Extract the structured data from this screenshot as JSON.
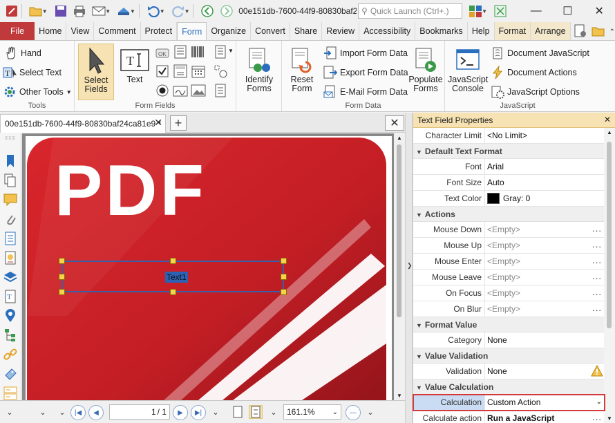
{
  "titlebar": {
    "title": "00e151db-7600-44f9-80830baf2...",
    "quick_launch_placeholder": "Quick Launch (Ctrl+.)"
  },
  "tabs": [
    {
      "label": "File"
    },
    {
      "label": "Home"
    },
    {
      "label": "View"
    },
    {
      "label": "Comment"
    },
    {
      "label": "Protect"
    },
    {
      "label": "Form"
    },
    {
      "label": "Organize"
    },
    {
      "label": "Convert"
    },
    {
      "label": "Share"
    },
    {
      "label": "Review"
    },
    {
      "label": "Accessibility"
    },
    {
      "label": "Bookmarks"
    },
    {
      "label": "Help"
    },
    {
      "label": "Format"
    },
    {
      "label": "Arrange"
    }
  ],
  "ribbon": {
    "tools": {
      "label": "Tools",
      "hand": "Hand",
      "select_text": "Select Text",
      "other_tools": "Other Tools"
    },
    "form_fields": {
      "label": "Form Fields",
      "select_fields_line1": "Select",
      "select_fields_line2": "Fields",
      "text": "Text",
      "ok_label": "OK"
    },
    "identify": {
      "line1": "Identify",
      "line2": "Forms"
    },
    "form_data": {
      "label": "Form Data",
      "reset_line1": "Reset",
      "reset_line2": "Form",
      "import": "Import Form Data",
      "export": "Export Form Data",
      "email": "E-Mail Form Data",
      "populate_line1": "Populate",
      "populate_line2": "Forms"
    },
    "javascript": {
      "label": "JavaScript",
      "console_line1": "JavaScript",
      "console_line2": "Console",
      "doc_js": "Document JavaScript",
      "doc_actions": "Document Actions",
      "js_options": "JavaScript Options"
    }
  },
  "document": {
    "tab_title": "00e151db-7600-44f9-80830baf24ca81e9 *",
    "page_text": "PDF",
    "field_label": "Text1"
  },
  "properties": {
    "title": "Text Field Properties",
    "character_limit": {
      "label": "Character Limit",
      "value": "<No Limit>"
    },
    "cat_default_format": "Default Text Format",
    "font": {
      "label": "Font",
      "value": "Arial"
    },
    "font_size": {
      "label": "Font Size",
      "value": "Auto"
    },
    "text_color": {
      "label": "Text Color",
      "value": "Gray: 0"
    },
    "cat_actions": "Actions",
    "mouse_down": {
      "label": "Mouse Down",
      "value": "<Empty>"
    },
    "mouse_up": {
      "label": "Mouse Up",
      "value": "<Empty>"
    },
    "mouse_enter": {
      "label": "Mouse Enter",
      "value": "<Empty>"
    },
    "mouse_leave": {
      "label": "Mouse Leave",
      "value": "<Empty>"
    },
    "on_focus": {
      "label": "On Focus",
      "value": "<Empty>"
    },
    "on_blur": {
      "label": "On Blur",
      "value": "<Empty>"
    },
    "cat_format_value": "Format Value",
    "category": {
      "label": "Category",
      "value": "None"
    },
    "cat_validation": "Value Validation",
    "validation": {
      "label": "Validation",
      "value": "None"
    },
    "cat_calculation": "Value Calculation",
    "calculation": {
      "label": "Calculation",
      "value": "Custom Action"
    },
    "calculate_action": {
      "label": "Calculate action",
      "value": "Run a JavaScript"
    },
    "ellipsis": "..."
  },
  "statusbar": {
    "page_value": "1",
    "page_total": "/ 1",
    "zoom": "161.1%"
  },
  "colors": {
    "file_tab": "#c0393b",
    "accent": "#2a6fbd",
    "highlight_border": "#d23b3b",
    "handle": "#f7d24a"
  }
}
